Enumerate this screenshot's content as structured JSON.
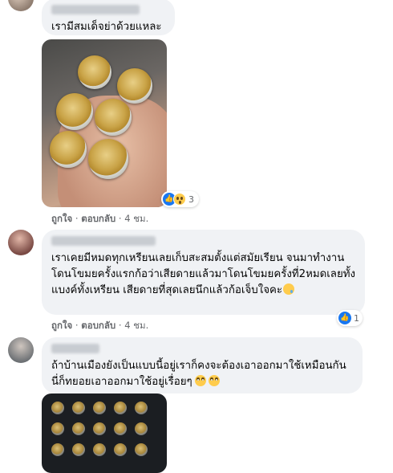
{
  "comments": [
    {
      "text": "เรามีสมเด็จย่าด้วยแหละ",
      "reactions": {
        "count": "3"
      },
      "actions": {
        "like": "ถูกใจ",
        "reply": "ตอบกลับ",
        "time": "4 ชม."
      }
    },
    {
      "text": "เราเคยมีหมดทุกเหรียนเลยเก็บสะสมตั้งแต่สมัยเรียน จนมาทำงานโดนโขมยครั้งแรกก้อว่าเสียดายแล้วมาโดนโขมยครั้งที่2หมดเลยทั้งแบงค์ทั้งเหรียน เสียดายที่สุดเลยนึกแล้วก้อเจ็บใจคะ",
      "reactions": {
        "count": "1"
      },
      "actions": {
        "like": "ถูกใจ",
        "reply": "ตอบกลับ",
        "time": "4 ชม."
      }
    },
    {
      "text": "ถ้าบ้านเมืองยังเป็นแบบนี้อยู่เราก็คงจะต้องเอาออกมาใช้เหมือนกันนี่ก็ทยอยเอาออกมาใช้อยู่เรื่อยๆ"
    }
  ],
  "separator": " · "
}
